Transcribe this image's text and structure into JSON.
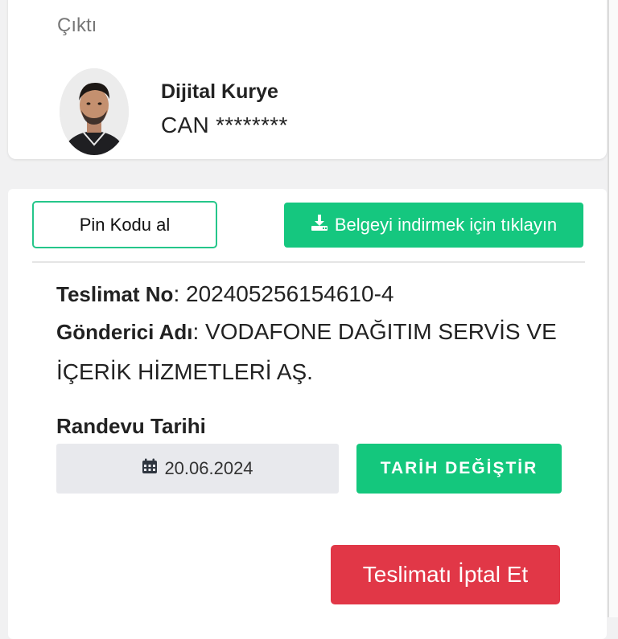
{
  "header": {
    "breadcrumb": "Çıktı",
    "courier": {
      "title": "Dijital Kurye",
      "name": "CAN ********"
    }
  },
  "actions": {
    "pin_button": "Pin Kodu al",
    "download_button": "Belgeyi indirmek için tıklayın"
  },
  "delivery": {
    "number_label": "Teslimat No",
    "number_value": ": 202405256154610-4",
    "sender_label": "Gönderici Adı",
    "sender_value": ": VODAFONE DAĞITIM SERVİS VE İÇERİK HİZMETLERİ AŞ."
  },
  "appointment": {
    "label": "Randevu Tarihi",
    "date": "20.06.2024",
    "change_button": "TARİH DEĞİŞTİR"
  },
  "cancel_button": "Teslimatı İptal Et",
  "colors": {
    "accent_green": "#15c77f",
    "danger_red": "#e13747",
    "outline_green": "#25c68a"
  },
  "icons": {
    "download": "download-icon",
    "calendar": "calendar-icon",
    "avatar": "avatar"
  }
}
